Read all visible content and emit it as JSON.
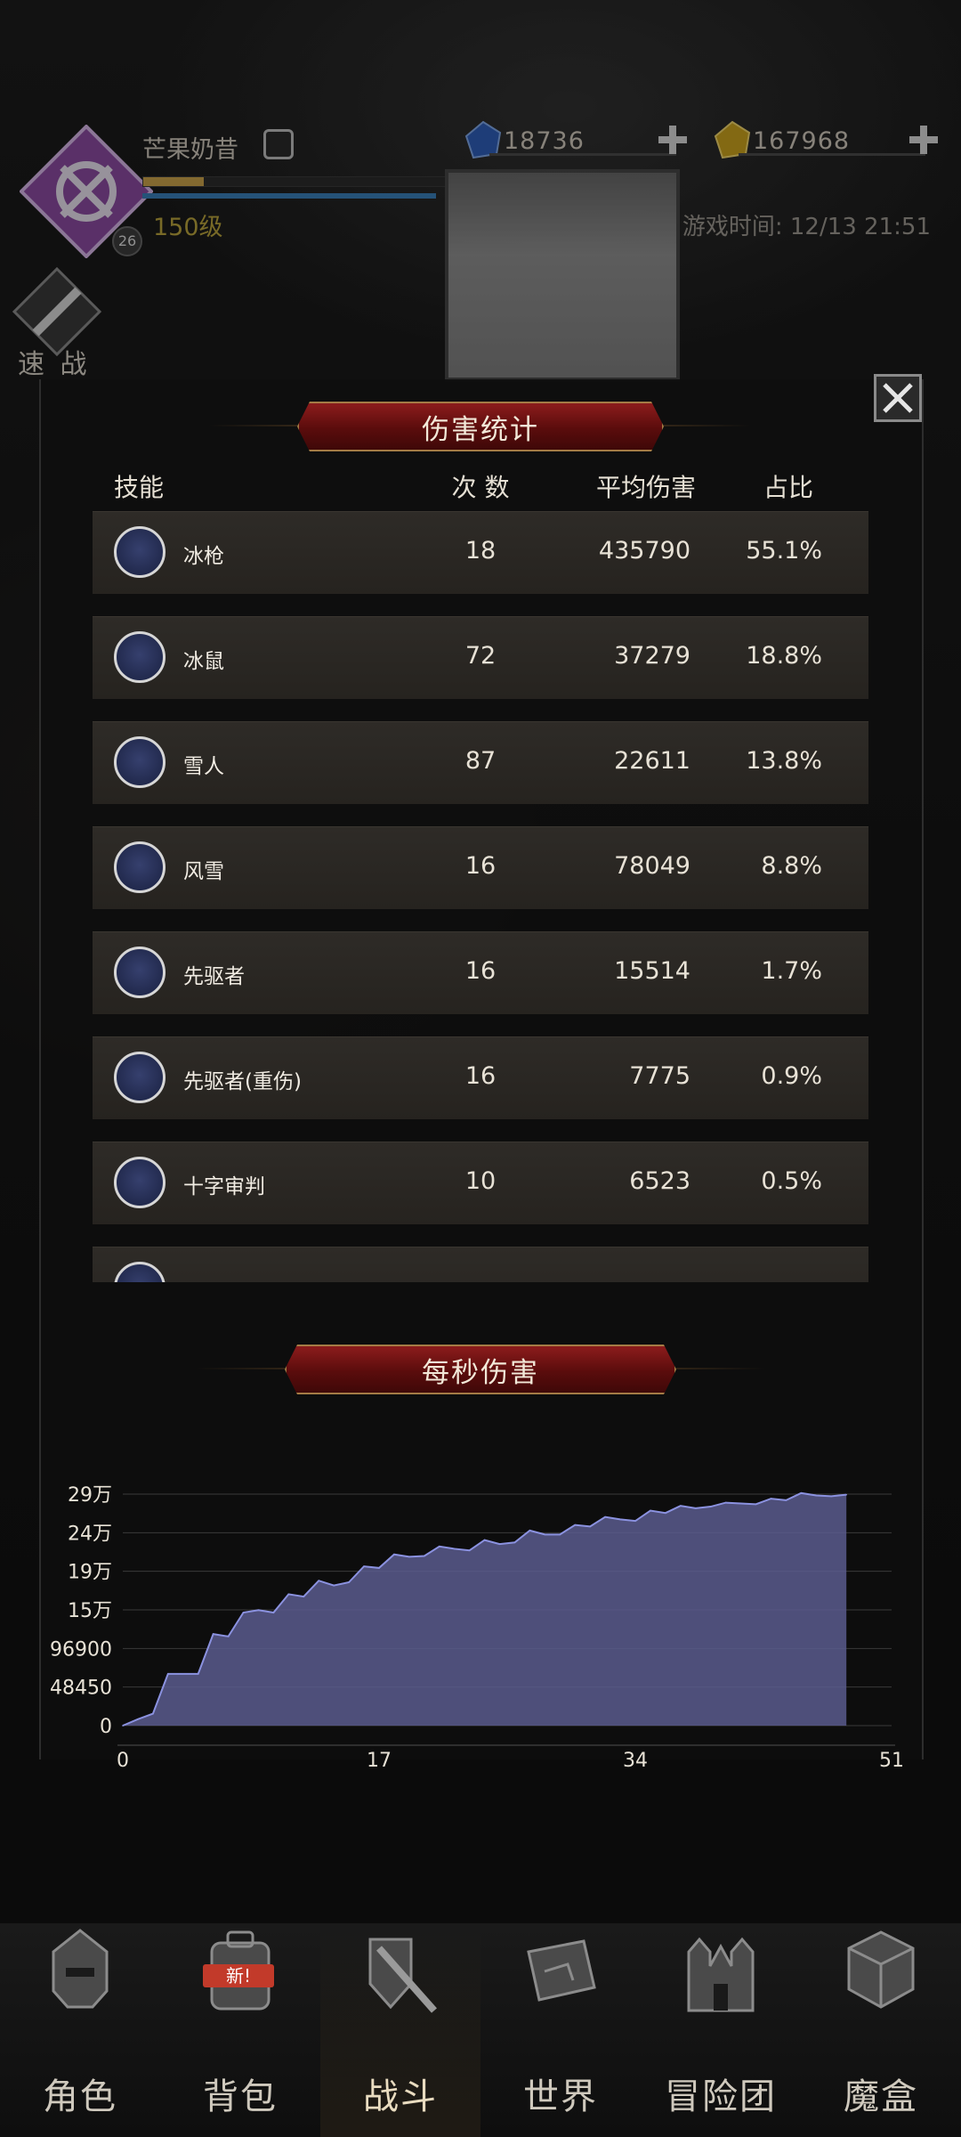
{
  "player": {
    "name": "芒果奶昔",
    "level": "150级",
    "badge": "26",
    "xp_fraction": 0.2
  },
  "currency": {
    "gems": "18736",
    "gold": "167968"
  },
  "game_time": "游戏时间: 12/13 21:51",
  "quick_battle_label": "速 战",
  "damage_stats": {
    "title": "伤害统计",
    "headers": {
      "skill": "技能",
      "count": "次 数",
      "avg": "平均伤害",
      "pct": "占比"
    },
    "rows": [
      {
        "icon": "ice-spear-icon",
        "name": "冰枪",
        "count": "18",
        "avg": "435790",
        "pct": "55.1%"
      },
      {
        "icon": "ice-rat-icon",
        "name": "冰鼠",
        "count": "72",
        "avg": "37279",
        "pct": "18.8%"
      },
      {
        "icon": "snowflake-icon",
        "name": "雪人",
        "count": "87",
        "avg": "22611",
        "pct": "13.8%"
      },
      {
        "icon": "sword-icon",
        "name": "风雪",
        "count": "16",
        "avg": "78049",
        "pct": "8.8%"
      },
      {
        "icon": "mushroom-cloud-icon",
        "name": "先驱者",
        "count": "16",
        "avg": "15514",
        "pct": "1.7%"
      },
      {
        "icon": "mushroom-cloud-icon",
        "name": "先驱者(重伤)",
        "count": "16",
        "avg": "7775",
        "pct": "0.9%"
      },
      {
        "icon": "banner-icon",
        "name": "十字审判",
        "count": "10",
        "avg": "6523",
        "pct": "0.5%"
      },
      {
        "icon": "sword-icon",
        "name": "",
        "count": "",
        "avg": "",
        "pct": ""
      }
    ]
  },
  "dps": {
    "title": "每秒伤害"
  },
  "chart_data": {
    "type": "area",
    "title": "每秒伤害",
    "xlabel": "",
    "ylabel": "",
    "xlim": [
      0,
      51
    ],
    "ylim": [
      0,
      290700
    ],
    "x_ticks": [
      "0",
      "17",
      "34",
      "51"
    ],
    "y_ticks": [
      "0",
      "48450",
      "96900",
      "15万",
      "19万",
      "24万",
      "29万"
    ],
    "y_tick_values": [
      0,
      48450,
      96900,
      145350,
      193800,
      242250,
      290700
    ],
    "color": "#5a5c8e",
    "x": [
      0,
      1,
      2,
      3,
      4,
      5,
      6,
      7,
      8,
      9,
      10,
      11,
      12,
      13,
      14,
      15,
      16,
      17,
      18,
      19,
      20,
      21,
      22,
      23,
      24,
      25,
      26,
      27,
      28,
      29,
      30,
      31,
      32,
      33,
      34,
      35,
      36,
      37,
      38,
      39,
      40,
      41,
      42,
      43,
      44,
      45,
      46,
      47,
      48
    ],
    "values": [
      0,
      8000,
      15000,
      65000,
      65000,
      65000,
      115000,
      112000,
      142000,
      145000,
      142000,
      165000,
      162000,
      182000,
      176000,
      180000,
      200000,
      198000,
      215000,
      212000,
      213000,
      225000,
      222000,
      220000,
      233000,
      228000,
      230000,
      245000,
      240000,
      240000,
      252000,
      250000,
      262000,
      259000,
      257000,
      270000,
      267000,
      276000,
      273000,
      275000,
      280000,
      279000,
      278000,
      285000,
      283000,
      292000,
      289000,
      288000,
      290000
    ]
  },
  "nav": [
    {
      "icon": "helmet-icon",
      "label": "角色"
    },
    {
      "icon": "backpack-icon",
      "label": "背包",
      "badge": "新!"
    },
    {
      "icon": "shield-sword-icon",
      "label": "战斗"
    },
    {
      "icon": "scroll-map-icon",
      "label": "世界"
    },
    {
      "icon": "castle-icon",
      "label": "冒险团"
    },
    {
      "icon": "cube-icon",
      "label": "魔盒"
    }
  ],
  "colors": {
    "banner_red": "#8c1c1c",
    "area_fill": "#5a5c8e",
    "area_line": "#8b92e0",
    "level_gold": "#b9a33c"
  }
}
